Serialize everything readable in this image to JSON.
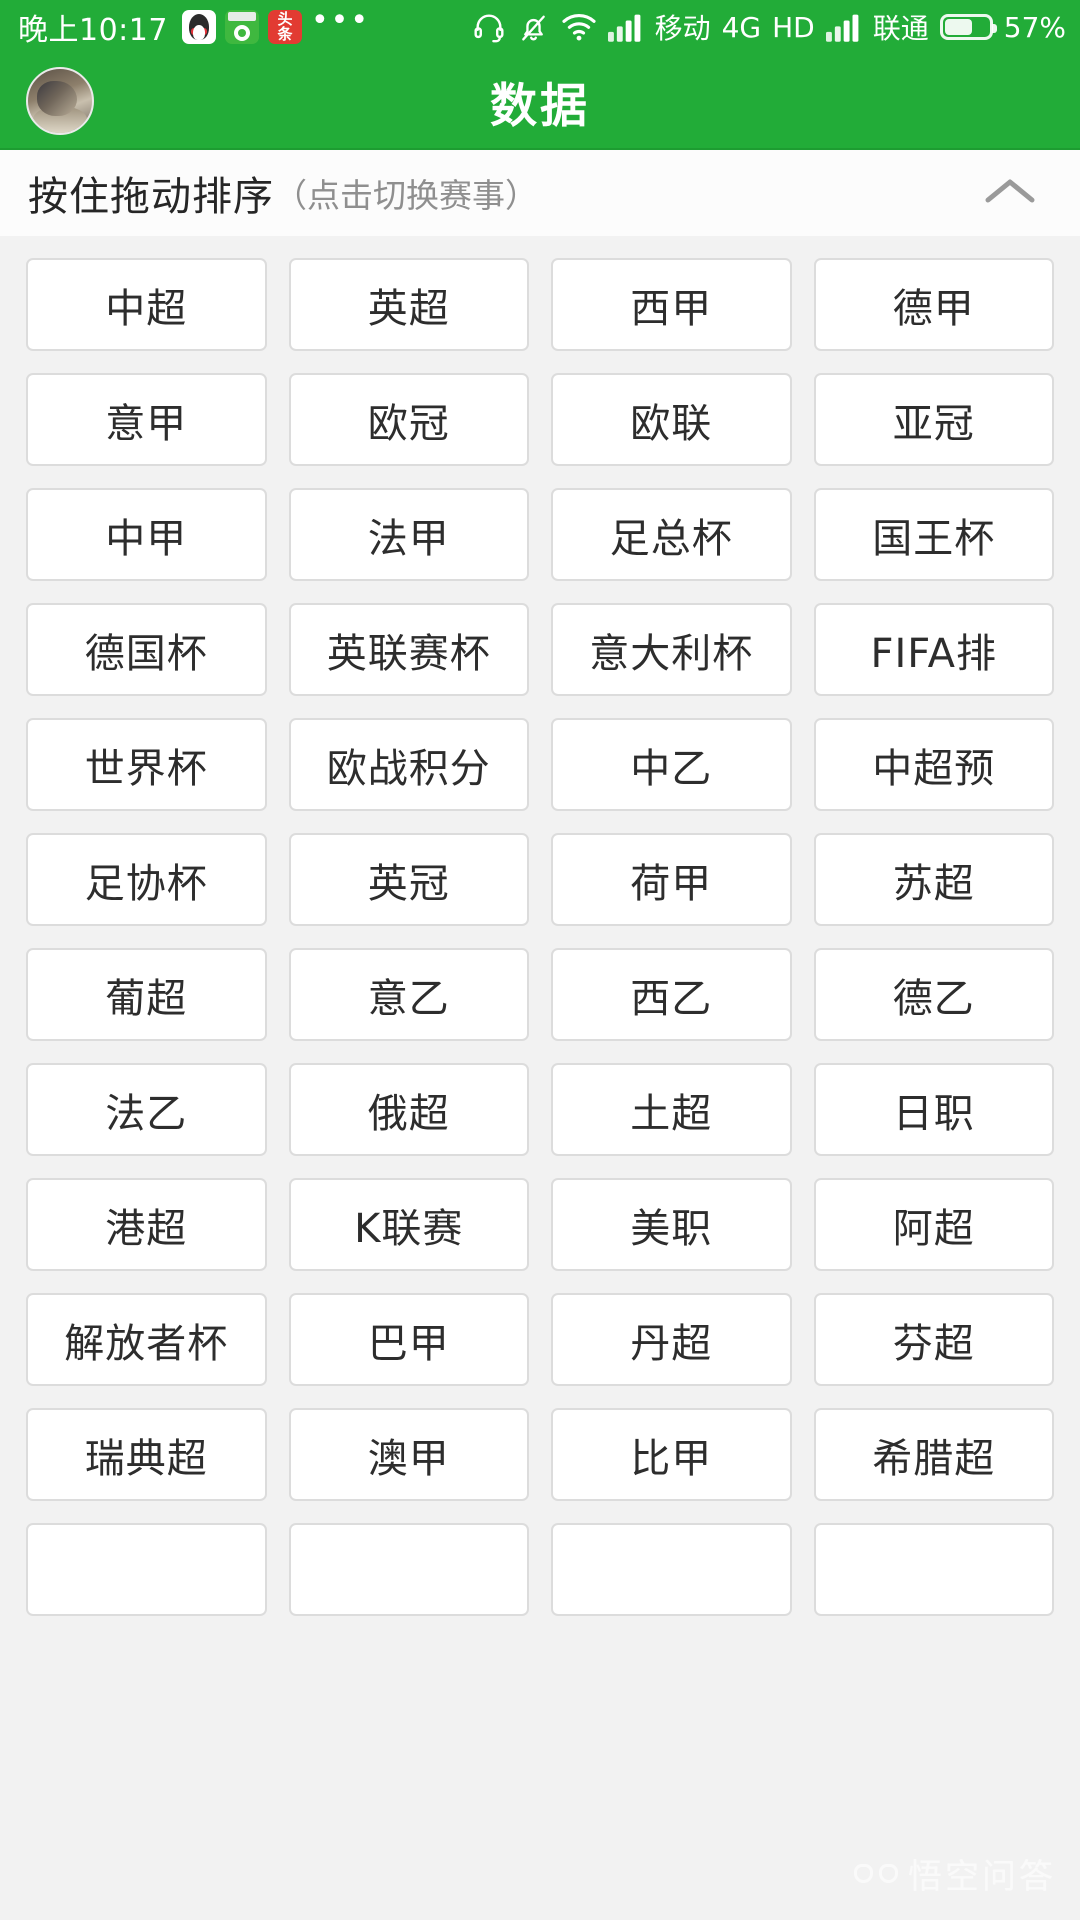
{
  "status_bar": {
    "time": "晚上10:17",
    "app_icons": [
      "qq-icon",
      "football-app-icon",
      "toutiao-icon",
      "more-dots-icon"
    ],
    "headset_icon": "headset-icon",
    "mute_icon": "bell-muted-icon",
    "wifi_icon": "wifi-icon",
    "signal_icon_1": "signal-bars-icon",
    "carrier_1": "移动",
    "network_type": "4G",
    "hd_label": "HD",
    "signal_icon_2": "signal-bars-icon",
    "carrier_2": "联通",
    "battery_icon": "battery-icon",
    "battery_percent": "57%"
  },
  "title_bar": {
    "avatar": "user-avatar",
    "title": "数据"
  },
  "section_header": {
    "title": "按住拖动排序",
    "subtitle": "（点击切换赛事）",
    "collapse_icon": "chevron-up-icon"
  },
  "leagues": [
    "中超",
    "英超",
    "西甲",
    "德甲",
    "意甲",
    "欧冠",
    "欧联",
    "亚冠",
    "中甲",
    "法甲",
    "足总杯",
    "国王杯",
    "德国杯",
    "英联赛杯",
    "意大利杯",
    "FIFA排",
    "世界杯",
    "欧战积分",
    "中乙",
    "中超预",
    "足协杯",
    "英冠",
    "荷甲",
    "苏超",
    "葡超",
    "意乙",
    "西乙",
    "德乙",
    "法乙",
    "俄超",
    "土超",
    "日职",
    "港超",
    "K联赛",
    "美职",
    "阿超",
    "解放者杯",
    "巴甲",
    "丹超",
    "芬超",
    "瑞典超",
    "澳甲",
    "比甲",
    "希腊超",
    "",
    "",
    "",
    ""
  ],
  "watermark": {
    "text": "悟空问答",
    "logo": "wukong-logo-icon"
  },
  "colors": {
    "brand_green": "#22ac38",
    "page_bg": "#f2f2f2",
    "cell_bg": "#ffffff",
    "cell_border": "#dcdcdc",
    "text_primary": "#2d2d2d",
    "text_muted": "#8f8f8f"
  }
}
